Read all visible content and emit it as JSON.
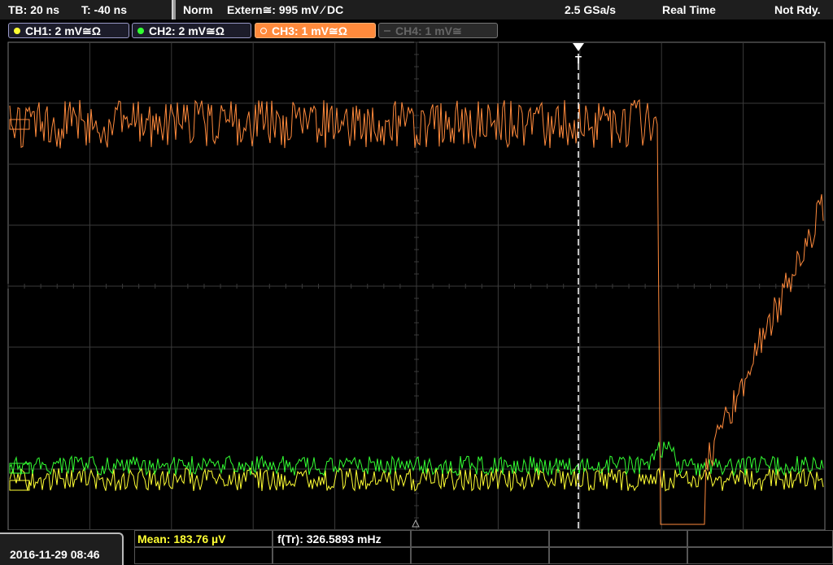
{
  "timebase": {
    "tb": "TB: 20 ns",
    "trig_pos": "T: -40 ns"
  },
  "trigger_bar": {
    "mode": "Norm",
    "source": "Extern≅: 995 mV ⁄ DC",
    "sample_rate": "2.5 GSa/s",
    "acq_mode": "Real Time",
    "status": "Not Rdy."
  },
  "channels": [
    {
      "label": "CH1: 2 mV≅Ω",
      "color": "#ffff33",
      "active": true
    },
    {
      "label": "CH2: 2 mV≅Ω",
      "color": "#33ff33",
      "active": true
    },
    {
      "label": "CH3: 1 mV≅Ω",
      "color": "#ff8a3c",
      "active": true
    },
    {
      "label": "CH4: 1 mV≅",
      "color": "#666666",
      "active": false
    }
  ],
  "measurements": {
    "mean": "Mean: 183.76 µV",
    "freq": "f(Tr): 326.5893 mHz"
  },
  "datetime": "2016-11-29 08:46",
  "trigger_marker": "T",
  "colors": {
    "grid": "#3a3a3a",
    "ch1": "#ffff33",
    "ch2": "#33ff33",
    "ch3": "#ff8a3c"
  }
}
